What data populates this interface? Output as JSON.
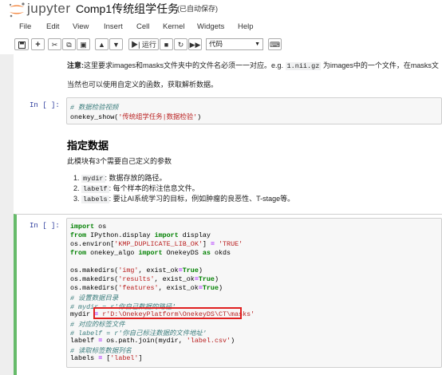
{
  "header": {
    "logo_text": "jupyter",
    "notebook_title": "Comp1传统组学任务",
    "save_status": "(已自动保存)"
  },
  "menu": [
    "File",
    "Edit",
    "View",
    "Insert",
    "Cell",
    "Kernel",
    "Widgets",
    "Help"
  ],
  "toolbar": {
    "run_label": "运行",
    "cell_type": "代码"
  },
  "note": {
    "bold": "注意:",
    "text1": "这里要求images和masks文件夹中的文件名必须一一对应。e.g. ",
    "code": "1.nii.gz",
    "text2": " 为images中的一个文件，在masks文",
    "line2": "当然也可以使用自定义的函数，获取解析数据。"
  },
  "cell1": {
    "prompt": "In  [ ]:",
    "lines": [
      "# 数据检验视频",
      "onekey_show('传统组学任务|数据检验')"
    ]
  },
  "section": {
    "heading": "指定数据",
    "intro": "此模块有3个需要自己定义的参数",
    "items": [
      {
        "num": "1.",
        "code": "mydir",
        "text": ": 数据存放的路径。"
      },
      {
        "num": "2.",
        "code": "labelf",
        "text": ": 每个样本的标注信息文件。"
      },
      {
        "num": "3.",
        "code": "labels",
        "text": ": 要让AI系统学习的目标，例如肿瘤的良恶性、T-stage等。"
      }
    ]
  },
  "cell2": {
    "prompt": "In  [ ]:",
    "lines": [
      "import os",
      "from IPython.display import display",
      "os.environ['KMP_DUPLICATE_LIB_OK'] = 'TRUE'",
      "from onekey_algo import OnekeyDS as okds",
      "",
      "os.makedirs('img', exist_ok=True)",
      "os.makedirs('results', exist_ok=True)",
      "os.makedirs('features', exist_ok=True)",
      "# 设置数据目录",
      "# mydir = r'你自己数据的路径'",
      "mydir = r'D:\\OnekeyPlatform\\OnekeyDS\\CT\\masks'",
      "# 对应的标签文件",
      "# labelf = r'你自己标注数据的文件地址'",
      "labelf = os.path.join(mydir, 'label.csv')",
      "# 读取标签数据列名",
      "labels = ['label']"
    ]
  }
}
